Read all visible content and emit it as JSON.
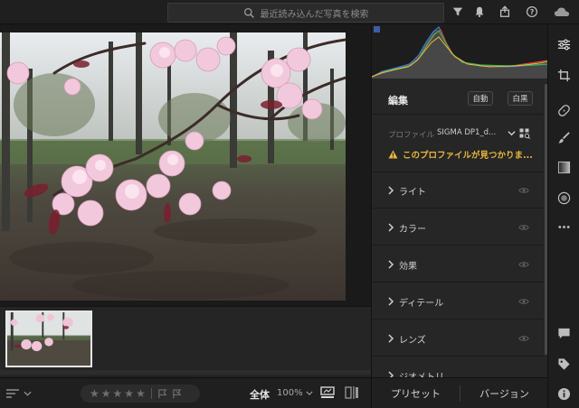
{
  "search": {
    "placeholder": "最近読み込んだ写真を検索"
  },
  "edit": {
    "title": "編集",
    "auto_label": "自動",
    "bw_label": "白黒",
    "profile_label": "プロファイル",
    "profile_value": "SIGMA DP1_d...",
    "profile_warning": "このプロファイルが見つかりま..."
  },
  "sections": [
    {
      "label": "ライト"
    },
    {
      "label": "カラー"
    },
    {
      "label": "効果"
    },
    {
      "label": "ディテール"
    },
    {
      "label": "レンズ"
    },
    {
      "label": "ジオメトリ"
    }
  ],
  "footer": {
    "presets_label": "プリセット",
    "versions_label": "バージョン"
  },
  "bottombar": {
    "all_label": "全体",
    "zoom_label": "100%"
  },
  "rating": {
    "max_stars": 5,
    "value": 0
  },
  "colors": {
    "warning": "#e8b73c",
    "panel_bg": "#262626",
    "app_bg": "#1e1e1e"
  },
  "icons": {
    "top": [
      "search-icon",
      "filter-icon",
      "bell-icon",
      "share-icon",
      "help-icon",
      "cloud-icon"
    ],
    "tools": [
      "edit-sliders-icon",
      "crop-icon",
      "healing-icon",
      "brush-icon",
      "linear-gradient-icon",
      "radial-gradient-icon",
      "more-icon",
      "comment-icon",
      "tag-icon",
      "info-icon"
    ]
  }
}
